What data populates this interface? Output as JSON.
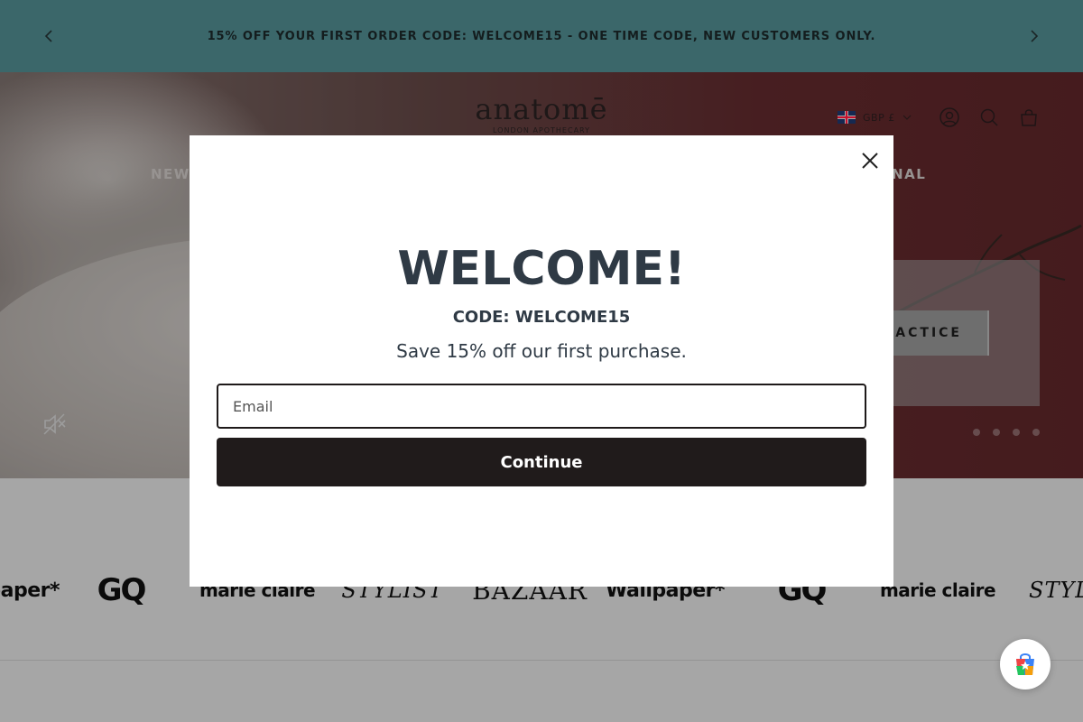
{
  "announcement": {
    "text": "15% OFF YOUR FIRST ORDER CODE: WELCOME15 - ONE TIME CODE, NEW CUSTOMERS ONLY.",
    "prev_icon": "chevron-left-icon",
    "next_icon": "chevron-right-icon"
  },
  "header": {
    "logo_word": "anatomē",
    "logo_sub": "LONDON APOTHECARY",
    "currency": "GBP £",
    "icons": [
      "account-icon",
      "search-icon",
      "bag-icon"
    ]
  },
  "nav": {
    "left_fragment": "NEW I",
    "right_fragment": "RNAL"
  },
  "hero": {
    "button_fragment": "RACTICE",
    "slide_count": 4
  },
  "press": {
    "logos": [
      "Wallpaper*",
      "GQ",
      "marie claire",
      "STYLIST",
      "BAZAAR",
      "Wallpaper*",
      "GQ",
      "marie claire",
      "STYLIST"
    ]
  },
  "modal": {
    "title": "WELCOME!",
    "code": "CODE: WELCOME15",
    "subtitle": "Save 15% off our first purchase.",
    "email_placeholder": "Email",
    "button_label": "Continue",
    "close_icon": "close-icon"
  },
  "colors": {
    "announcement_bg": "#5b9ea3",
    "modal_text": "#2f3a45",
    "button_bg": "#201b1b"
  }
}
